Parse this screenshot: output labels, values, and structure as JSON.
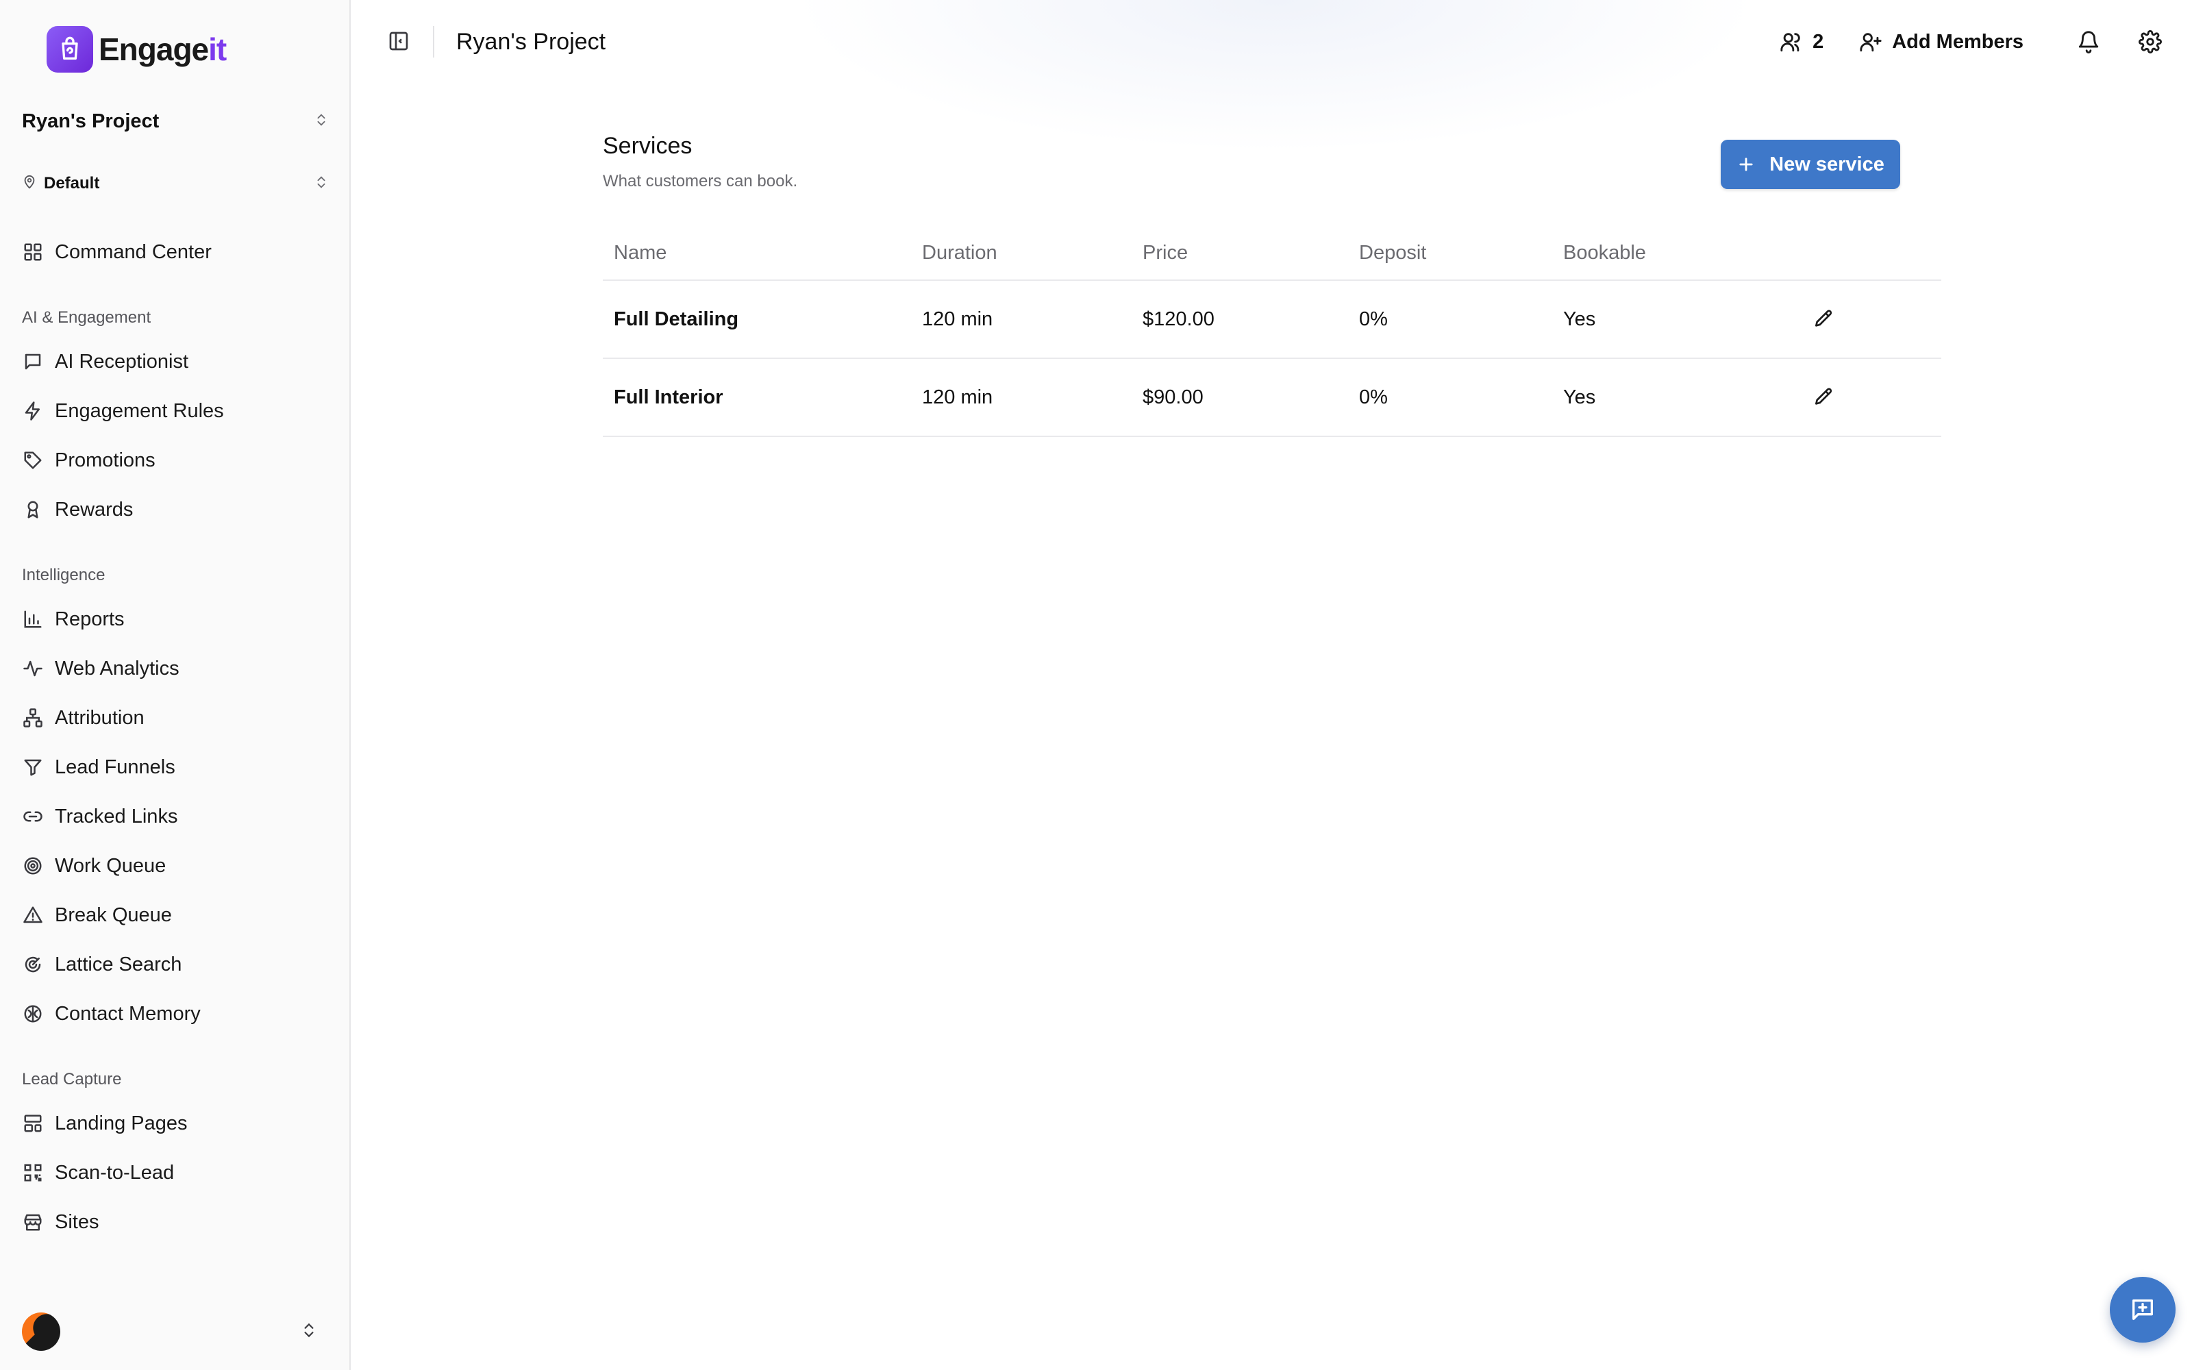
{
  "brand": {
    "name_main": "Engage",
    "name_accent": "it",
    "accent_color": "#7c3aed"
  },
  "sidebar": {
    "project": "Ryan's Project",
    "location": "Default",
    "top_items": [
      {
        "label": "Command Center",
        "icon": "grid-icon"
      }
    ],
    "sections": [
      {
        "title": "AI & Engagement",
        "items": [
          {
            "label": "AI Receptionist",
            "icon": "message-icon"
          },
          {
            "label": "Engagement Rules",
            "icon": "zap-icon"
          },
          {
            "label": "Promotions",
            "icon": "tag-icon"
          },
          {
            "label": "Rewards",
            "icon": "award-icon"
          }
        ]
      },
      {
        "title": "Intelligence",
        "items": [
          {
            "label": "Reports",
            "icon": "bar-chart-icon"
          },
          {
            "label": "Web Analytics",
            "icon": "activity-icon"
          },
          {
            "label": "Attribution",
            "icon": "network-icon"
          },
          {
            "label": "Lead Funnels",
            "icon": "filter-icon"
          },
          {
            "label": "Tracked Links",
            "icon": "link-icon"
          },
          {
            "label": "Work Queue",
            "icon": "target-icon"
          },
          {
            "label": "Break Queue",
            "icon": "alert-triangle-icon"
          },
          {
            "label": "Lattice Search",
            "icon": "radar-icon"
          },
          {
            "label": "Contact Memory",
            "icon": "brain-icon"
          }
        ]
      },
      {
        "title": "Lead Capture",
        "items": [
          {
            "label": "Landing Pages",
            "icon": "layout-icon"
          },
          {
            "label": "Scan-to-Lead",
            "icon": "qr-code-icon"
          },
          {
            "label": "Sites",
            "icon": "store-icon"
          }
        ]
      }
    ]
  },
  "topbar": {
    "title": "Ryan's Project",
    "members_count": "2",
    "add_members_label": "Add Members"
  },
  "services": {
    "title": "Services",
    "subtitle": "What customers can book.",
    "new_button_label": "New service",
    "columns": {
      "name": "Name",
      "duration": "Duration",
      "price": "Price",
      "deposit": "Deposit",
      "bookable": "Bookable"
    },
    "rows": [
      {
        "name": "Full Detailing",
        "duration": "120 min",
        "price": "$120.00",
        "deposit": "0%",
        "bookable": "Yes"
      },
      {
        "name": "Full Interior",
        "duration": "120 min",
        "price": "$90.00",
        "deposit": "0%",
        "bookable": "Yes"
      }
    ]
  },
  "colors": {
    "primary_button": "#3e78c9",
    "sidebar_bg": "#fafafa"
  }
}
